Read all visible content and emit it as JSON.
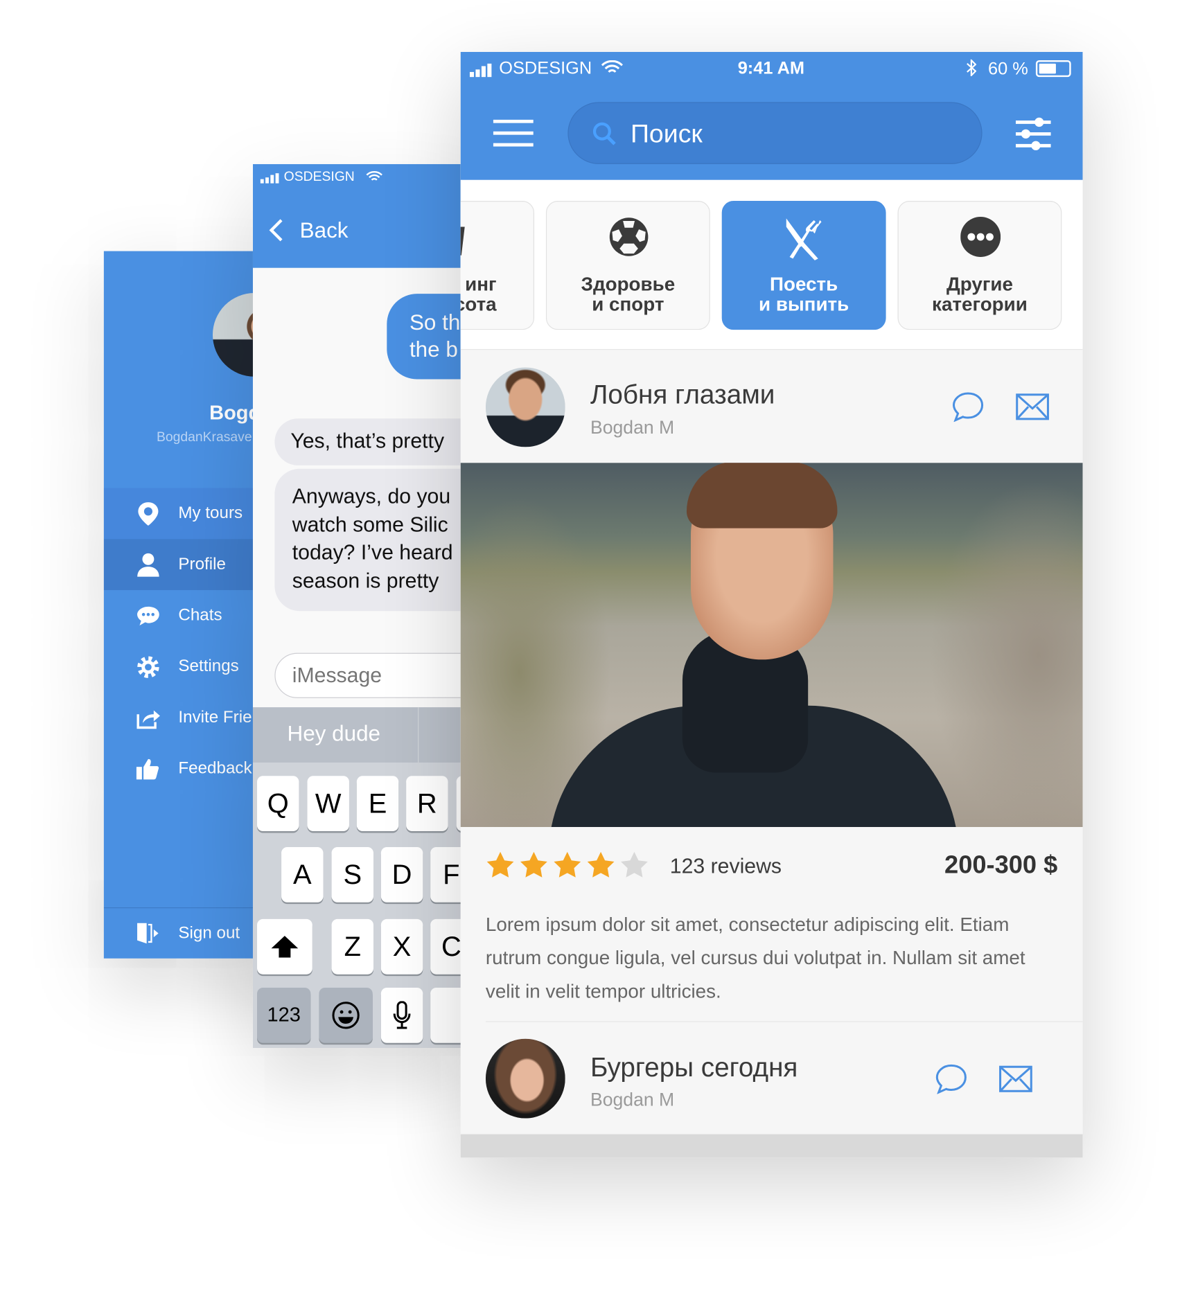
{
  "colors": {
    "brand": "#4a90e2",
    "star": "#f5a623",
    "star_empty": "#d8d8d8"
  },
  "sidebar": {
    "user_name": "Bogd",
    "user_handle": "BogdanKrasave",
    "items": [
      {
        "label": "My tours",
        "icon": "map-pin-icon"
      },
      {
        "label": "Profile",
        "icon": "user-icon",
        "active": true
      },
      {
        "label": "Chats",
        "icon": "chat-bubble-icon"
      },
      {
        "label": "Settings",
        "icon": "gear-icon"
      },
      {
        "label": "Invite Frie",
        "icon": "share-icon"
      },
      {
        "label": "Feedback",
        "icon": "thumbs-up-icon"
      }
    ],
    "sign_out": "Sign out"
  },
  "chat": {
    "status": {
      "carrier": "OSDESIGN"
    },
    "back_label": "Back",
    "messages": [
      {
        "from": "me",
        "lines": [
          "So th",
          "the b"
        ]
      },
      {
        "from": "them",
        "lines": [
          "Yes, that’s pretty"
        ]
      },
      {
        "from": "them",
        "lines": [
          "Anyways, do you",
          "watch some Silic",
          "today? I’ve heard",
          "season is pretty"
        ]
      }
    ],
    "input_placeholder": "iMessage",
    "suggestion": "Hey dude",
    "keyboard": {
      "row1": [
        "Q",
        "W",
        "E",
        "R"
      ],
      "row2": [
        "A",
        "S",
        "D",
        "F"
      ],
      "row3": [
        "Z",
        "X",
        "C"
      ],
      "numbers_key": "123"
    }
  },
  "main": {
    "status": {
      "carrier": "OSDESIGN",
      "time": "9:41 AM",
      "battery": "60 %",
      "battery_level": 60
    },
    "search_placeholder": "Поиск",
    "categories": [
      {
        "label_1": "инг",
        "label_2": "сота",
        "icon": "cup-icon"
      },
      {
        "label_1": "Здоровье",
        "label_2": "и спорт",
        "icon": "soccer-ball-icon"
      },
      {
        "label_1": "Поесть",
        "label_2": "и выпить",
        "icon": "knife-fork-icon",
        "active": true
      },
      {
        "label_1": "Другие",
        "label_2": "категории",
        "icon": "more-dots-icon"
      }
    ],
    "posts": [
      {
        "title": "Лобня глазами",
        "author": "Bogdan M",
        "rating": 4,
        "rating_max": 5,
        "reviews": "123 reviews",
        "price": "200-300 $",
        "description": "Lorem ipsum dolor sit amet, consectetur adipiscing elit. Etiam rutrum congue ligula, vel cursus dui volutpat in. Nullam sit amet velit in velit tempor ultricies."
      },
      {
        "title": "Бургеры сегодня",
        "author": "Bogdan M"
      }
    ]
  }
}
